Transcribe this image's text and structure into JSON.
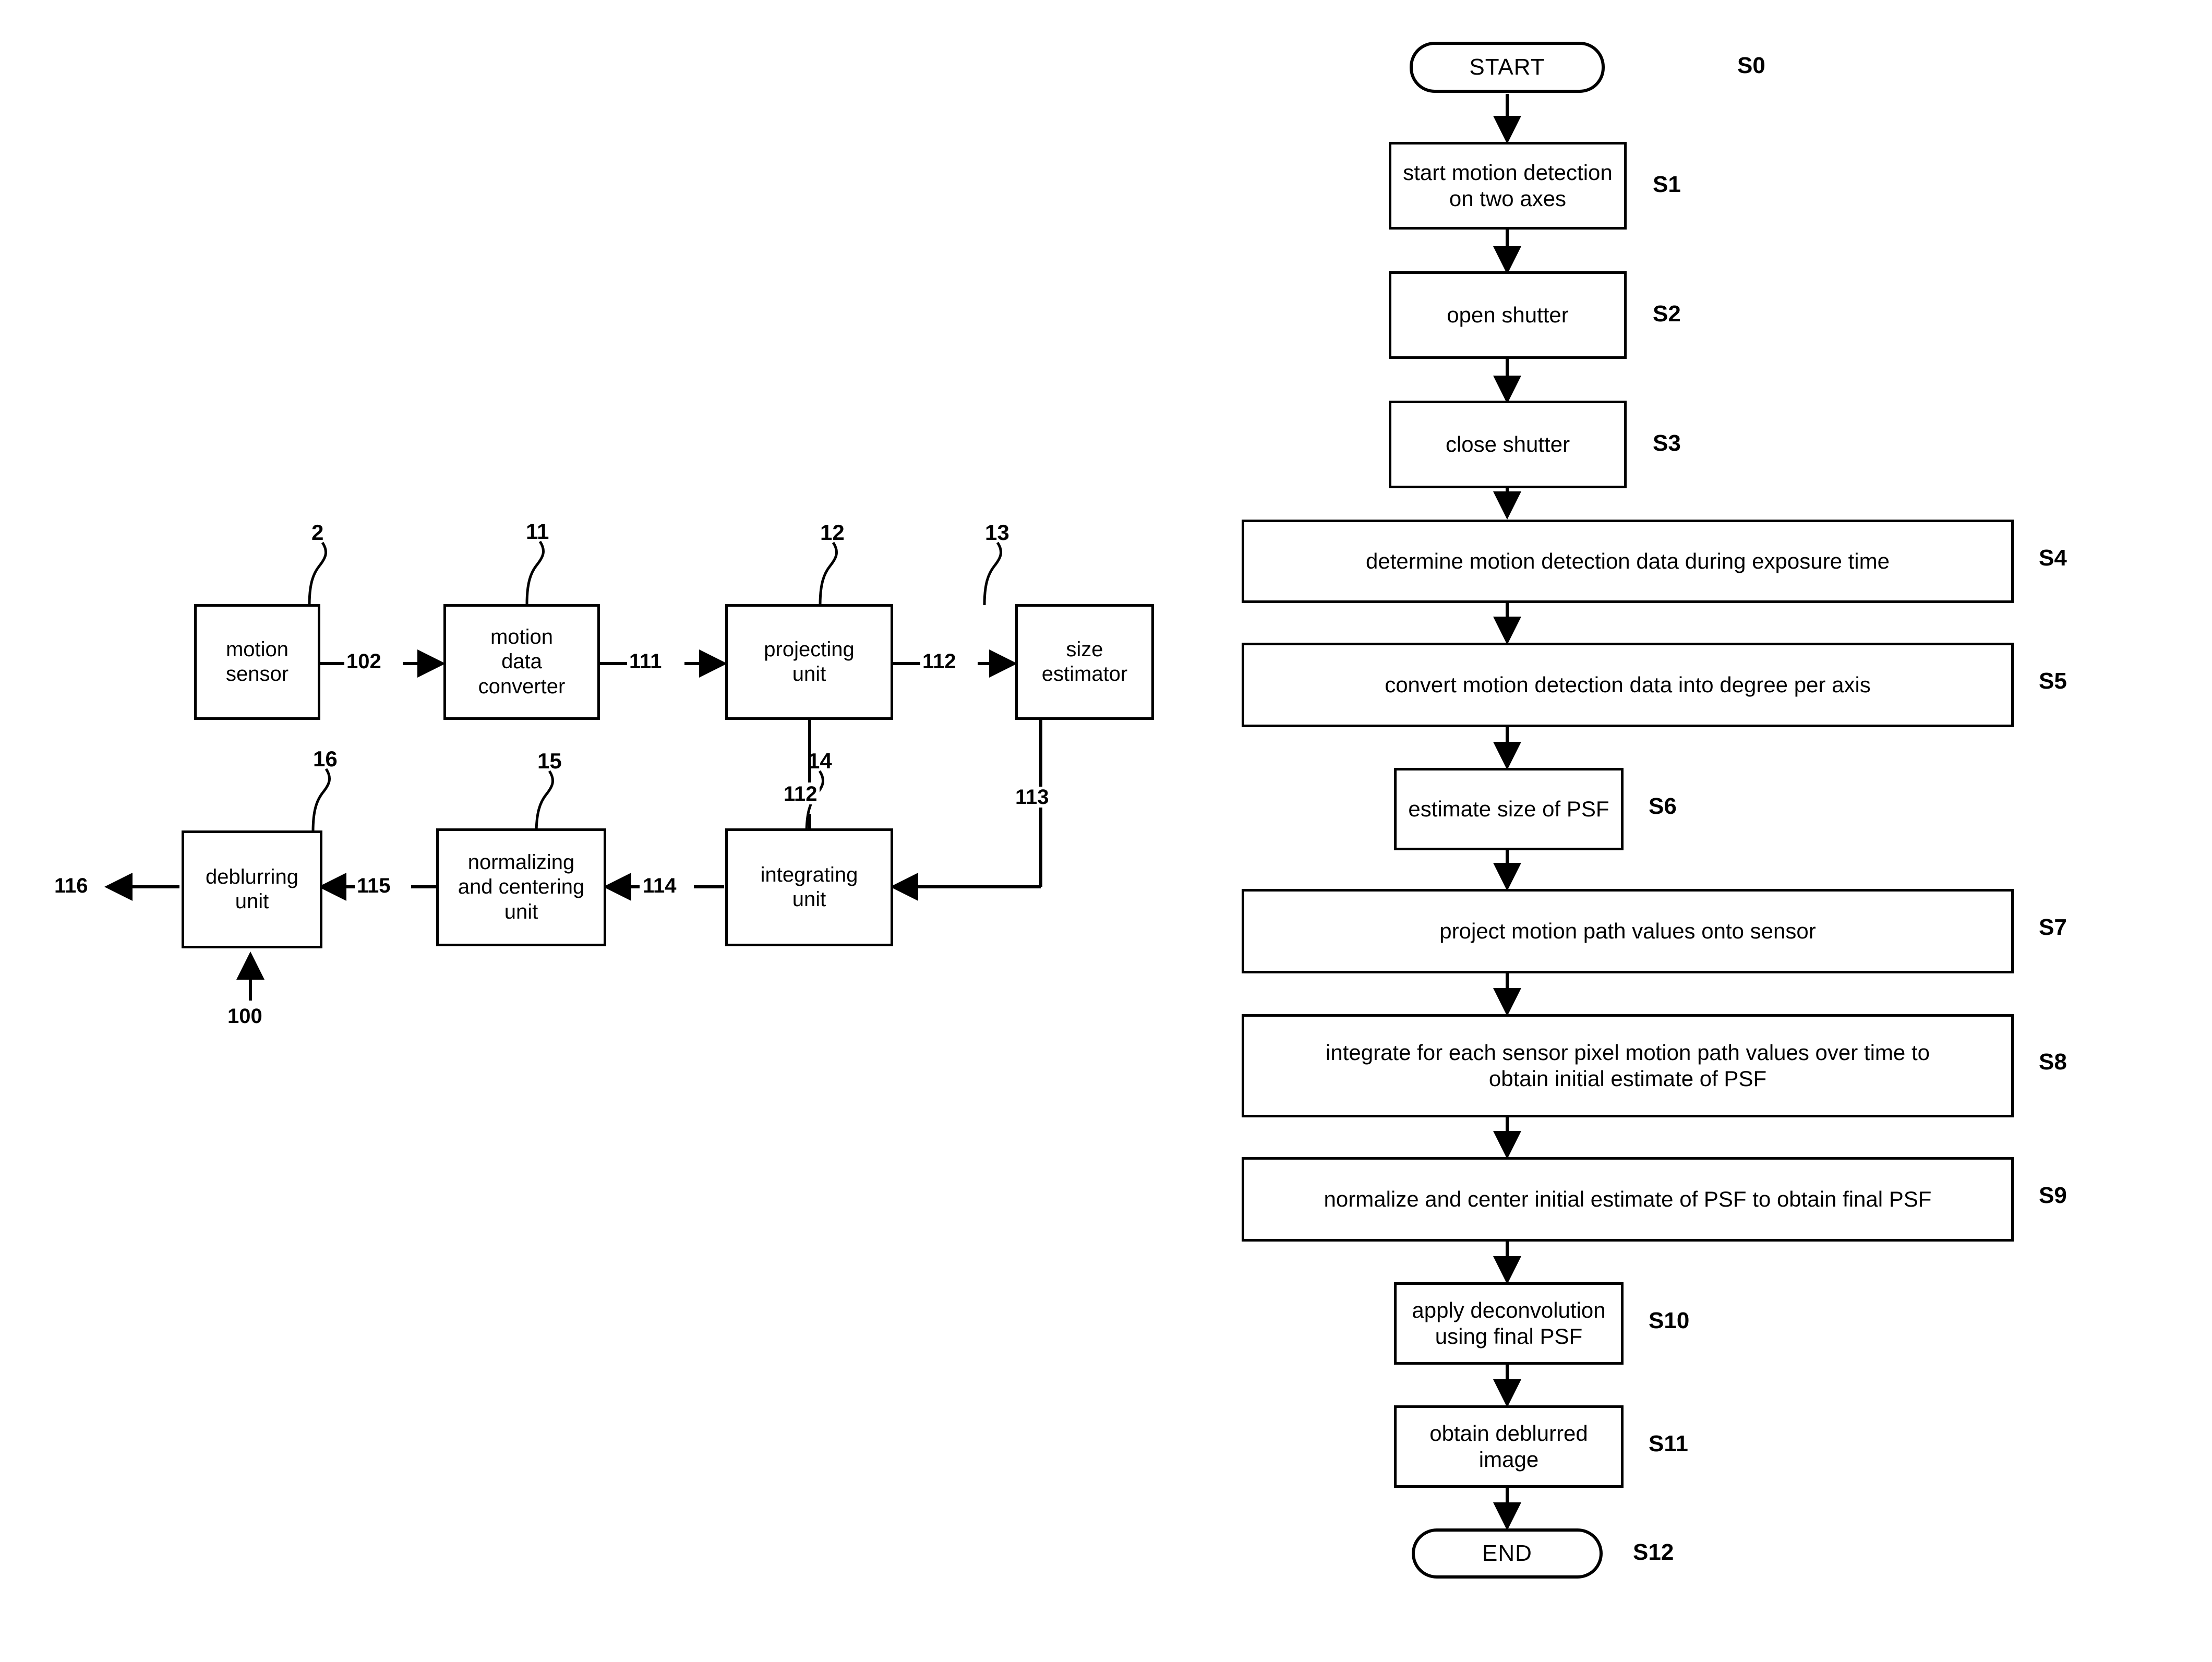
{
  "figure": {
    "block_diagram": {
      "title_ref": "100",
      "blocks": [
        {
          "id": "motion-sensor",
          "label": "motion\nsensor",
          "ref": "2"
        },
        {
          "id": "motion-data-converter",
          "label": "motion\ndata\nconverter",
          "ref": "11"
        },
        {
          "id": "projecting-unit",
          "label": "projecting\nunit",
          "ref": "12"
        },
        {
          "id": "size-estimator",
          "label": "size\nestimator",
          "ref": "13"
        },
        {
          "id": "integrating-unit",
          "label": "integrating\nunit",
          "ref": "14"
        },
        {
          "id": "normalizing-and-centering-unit",
          "label": "normalizing\nand centering\nunit",
          "ref": "15"
        },
        {
          "id": "deblurring-unit",
          "label": "deblurring\nunit",
          "ref": "16"
        }
      ],
      "signals": [
        {
          "id": "sig-102",
          "label": "102"
        },
        {
          "id": "sig-111",
          "label": "111"
        },
        {
          "id": "sig-112a",
          "label": "112"
        },
        {
          "id": "sig-112b",
          "label": "112"
        },
        {
          "id": "sig-113",
          "label": "113"
        },
        {
          "id": "sig-114",
          "label": "114"
        },
        {
          "id": "sig-115",
          "label": "115"
        },
        {
          "id": "sig-116",
          "label": "116"
        },
        {
          "id": "sig-100",
          "label": "100"
        }
      ]
    },
    "flowchart": {
      "nodes": [
        {
          "id": "s0",
          "tag": "S0",
          "type": "terminator",
          "label": "START"
        },
        {
          "id": "s1",
          "tag": "S1",
          "type": "process",
          "label": "start motion detection on two axes"
        },
        {
          "id": "s2",
          "tag": "S2",
          "type": "process",
          "label": "open shutter"
        },
        {
          "id": "s3",
          "tag": "S3",
          "type": "process",
          "label": "close shutter"
        },
        {
          "id": "s4",
          "tag": "S4",
          "type": "process",
          "label": "determine motion detection data during exposure time"
        },
        {
          "id": "s5",
          "tag": "S5",
          "type": "process",
          "label": "convert motion detection data into degree per axis"
        },
        {
          "id": "s6",
          "tag": "S6",
          "type": "process",
          "label": "estimate size of PSF"
        },
        {
          "id": "s7",
          "tag": "S7",
          "type": "process",
          "label": "project motion path values onto sensor"
        },
        {
          "id": "s8",
          "tag": "S8",
          "type": "process",
          "label": "integrate for each sensor pixel motion path values over time to\nobtain initial estimate of PSF"
        },
        {
          "id": "s9",
          "tag": "S9",
          "type": "process",
          "label": "normalize and center initial estimate of  PSF to obtain final PSF"
        },
        {
          "id": "s10",
          "tag": "S10",
          "type": "process",
          "label": "apply deconvolution using final PSF"
        },
        {
          "id": "s11",
          "tag": "S11",
          "type": "process",
          "label": "obtain deblurred image"
        },
        {
          "id": "s12",
          "tag": "S12",
          "type": "terminator",
          "label": "END"
        }
      ]
    }
  },
  "colors": {
    "ink": "#000000",
    "paper": "#ffffff"
  }
}
